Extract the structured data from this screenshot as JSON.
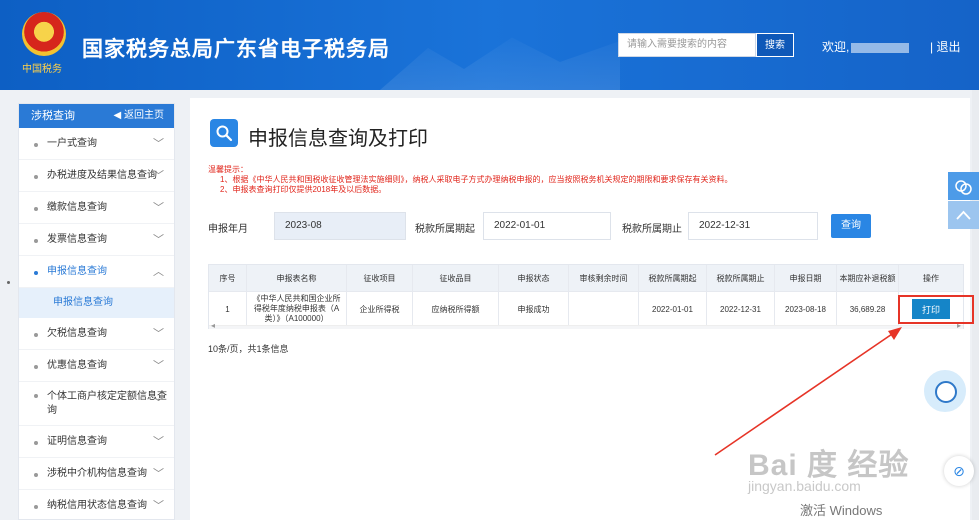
{
  "header": {
    "emblem_text": "中国税务",
    "site_title": "国家税务总局广东省电子税务局",
    "search_placeholder": "请输入需要搜索的内容",
    "search_button": "搜索",
    "welcome": "欢迎,",
    "logout": "| 退出"
  },
  "sidebar": {
    "title": "涉税查询",
    "home": "◀ 返回主页",
    "items": [
      {
        "label": "一户式查询",
        "chev": "﹀"
      },
      {
        "label": "办税进度及结果信息查询",
        "chev": "﹀"
      },
      {
        "label": "缴款信息查询",
        "chev": "﹀"
      },
      {
        "label": "发票信息查询",
        "chev": "﹀"
      },
      {
        "label": "申报信息查询",
        "chev": "︿"
      },
      {
        "label": "欠税信息查询",
        "chev": "﹀"
      },
      {
        "label": "优惠信息查询",
        "chev": "﹀"
      },
      {
        "label": "个体工商户核定定额信息查询",
        "chev": "﹀"
      },
      {
        "label": "证明信息查询",
        "chev": "﹀"
      },
      {
        "label": "涉税中介机构信息查询",
        "chev": "﹀"
      },
      {
        "label": "纳税信用状态信息查询",
        "chev": "﹀"
      }
    ],
    "sub_item": "申报信息查询"
  },
  "main": {
    "title": "申报信息查询及打印",
    "tips_title": "温馨提示：",
    "tips": [
      "1、根据《中华人民共和国税收征收管理法实施细则》，纳税人采取电子方式办理纳税申报的，应当按照税务机关规定的期限和要求保存有关资料。",
      "2、申报表查询打印仅提供2018年及以后数据。"
    ],
    "filters": {
      "month_label": "申报年月",
      "month_value": "2023-08",
      "start_label": "税款所属期起",
      "start_value": "2022-01-01",
      "end_label": "税款所属期止",
      "end_value": "2022-12-31",
      "query_button": "查询"
    },
    "table": {
      "headers": [
        "序号",
        "申报表名称",
        "征收项目",
        "征收品目",
        "申报状态",
        "审核剩余时间",
        "税款所属期起",
        "税款所属期止",
        "申报日期",
        "本期应补退税额",
        "操作"
      ],
      "rows": [
        [
          "1",
          "《中华人民共和国企业所得税年度纳税申报表（A类）》（A100000）",
          "企业所得税",
          "应纳税所得额",
          "申报成功",
          "",
          "2022-01-01",
          "2022-12-31",
          "2023-08-18",
          "36,689.28",
          "打印"
        ]
      ]
    },
    "pagination": "10条/页，共1条信息"
  },
  "overlay": {
    "watermark": "Bai 度 经验",
    "watermark_sub": "jingyan.baidu.com",
    "activate": "激活 Windows",
    "annotation_color": "#e63427"
  }
}
